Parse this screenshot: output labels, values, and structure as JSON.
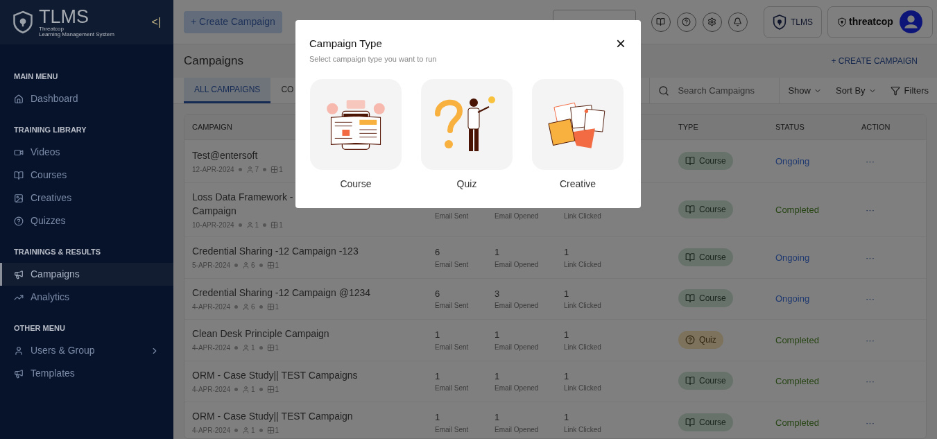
{
  "sidebar": {
    "brand": {
      "title": "TLMS",
      "line1": "Threatcop",
      "line2": "Learning Management System",
      "collapse": "<|"
    },
    "sections": [
      {
        "heading": "MAIN MENU",
        "items": [
          {
            "label": "Dashboard",
            "selected": false,
            "has_children": false
          }
        ]
      },
      {
        "heading": "TRAINING LIBRARY",
        "items": [
          {
            "label": "Videos",
            "selected": false,
            "has_children": false
          },
          {
            "label": "Courses",
            "selected": false,
            "has_children": false
          },
          {
            "label": "Creatives",
            "selected": false,
            "has_children": false
          },
          {
            "label": "Quizzes",
            "selected": false,
            "has_children": false
          }
        ]
      },
      {
        "heading": "TRAININGS & RESULTS",
        "items": [
          {
            "label": "Campaigns",
            "selected": true,
            "has_children": false
          },
          {
            "label": "Analytics",
            "selected": false,
            "has_children": false
          }
        ]
      },
      {
        "heading": "OTHER MENU",
        "items": [
          {
            "label": "Users & Group",
            "selected": false,
            "has_children": true
          },
          {
            "label": "Templates",
            "selected": false,
            "has_children": false
          }
        ]
      }
    ]
  },
  "header": {
    "create_button": "+ Create Campaign",
    "tlms_button": "TLMS",
    "org_logo": "threatcop"
  },
  "page": {
    "title": "Campaigns",
    "create_link": "+ CREATE CAMPAIGN",
    "tabs": [
      {
        "label": "ALL CAMPAIGNS",
        "selected": true
      },
      {
        "label": "CO",
        "selected": false
      }
    ],
    "search": {
      "placeholder": "Search Campaigns"
    },
    "show": "Show",
    "sort": "Sort By",
    "filters": "Filters"
  },
  "table": {
    "columns": {
      "campaign": "CAMPAIGN",
      "type": "TYPE",
      "status": "STATUS",
      "action": "ACTION"
    },
    "rows": [
      {
        "name": "Test@entersoft",
        "date": "12-APR-2024",
        "users": "7",
        "groups": "1",
        "stats": [],
        "type": {
          "kind": "course",
          "label": "Course"
        },
        "status": {
          "kind": "ongoing",
          "label": "Ongoing"
        },
        "action": "···"
      },
      {
        "name": "Loss Data Framework -",
        "name2": "Campaign",
        "date": "10-APR-2024",
        "users": "1",
        "groups": "1",
        "stats": [
          {
            "label": "Email Sent"
          },
          {
            "label": "Email Opened"
          },
          {
            "label": "Link Clicked"
          }
        ],
        "type": {
          "kind": "course",
          "label": "Course"
        },
        "status": {
          "kind": "completed",
          "label": "Completed"
        },
        "action": "···"
      },
      {
        "name": "Credential Sharing -12 Campaign -123",
        "date": "5-APR-2024",
        "users": "6",
        "groups": "1",
        "stats": [
          {
            "value": "6",
            "label": "Email Sent"
          },
          {
            "value": "1",
            "label": "Email Opened"
          },
          {
            "value": "1",
            "label": "Link Clicked"
          }
        ],
        "type": {
          "kind": "course",
          "label": "Course"
        },
        "status": {
          "kind": "ongoing",
          "label": "Ongoing"
        },
        "action": "···"
      },
      {
        "name": "Credential Sharing -12 Campaign @1234",
        "date": "4-APR-2024",
        "users": "6",
        "groups": "1",
        "stats": [
          {
            "value": "6",
            "label": "Email Sent"
          },
          {
            "value": "3",
            "label": "Email Opened"
          },
          {
            "value": "1",
            "label": "Link Clicked"
          }
        ],
        "type": {
          "kind": "course",
          "label": "Course"
        },
        "status": {
          "kind": "ongoing",
          "label": "Ongoing"
        },
        "action": "···"
      },
      {
        "name": "Clean Desk Principle Campaign",
        "date": "4-APR-2024",
        "users": "1",
        "groups": "1",
        "stats": [
          {
            "value": "1",
            "label": "Email Sent"
          },
          {
            "value": "1",
            "label": "Email Opened"
          },
          {
            "value": "1",
            "label": "Link Clicked"
          }
        ],
        "type": {
          "kind": "quiz",
          "label": "Quiz"
        },
        "status": {
          "kind": "completed",
          "label": "Completed"
        },
        "action": "···"
      },
      {
        "name": "ORM - Case Study|| TEST Campaigns",
        "date": "4-APR-2024",
        "users": "1",
        "groups": "1",
        "stats": [
          {
            "value": "1",
            "label": "Email Sent"
          },
          {
            "value": "1",
            "label": "Email Opened"
          },
          {
            "value": "1",
            "label": "Link Clicked"
          }
        ],
        "type": {
          "kind": "course",
          "label": "Course"
        },
        "status": {
          "kind": "completed",
          "label": "Completed"
        },
        "action": "···"
      },
      {
        "name": "ORM - Case Study|| TEST Campaign",
        "date": "4-APR-2024",
        "users": "1",
        "groups": "1",
        "stats": [
          {
            "value": "1",
            "label": "Email Sent"
          },
          {
            "value": "1",
            "label": "Email Opened"
          },
          {
            "value": "1",
            "label": "Link Clicked"
          }
        ],
        "type": {
          "kind": "course",
          "label": "Course"
        },
        "status": {
          "kind": "completed",
          "label": "Completed"
        },
        "action": "···"
      }
    ]
  },
  "modal": {
    "title": "Campaign Type",
    "subtitle": "Select campaign type you want to run",
    "close": "×",
    "options": [
      {
        "kind": "course",
        "label": "Course"
      },
      {
        "kind": "quiz",
        "label": "Quiz"
      },
      {
        "kind": "creative",
        "label": "Creative"
      }
    ]
  }
}
